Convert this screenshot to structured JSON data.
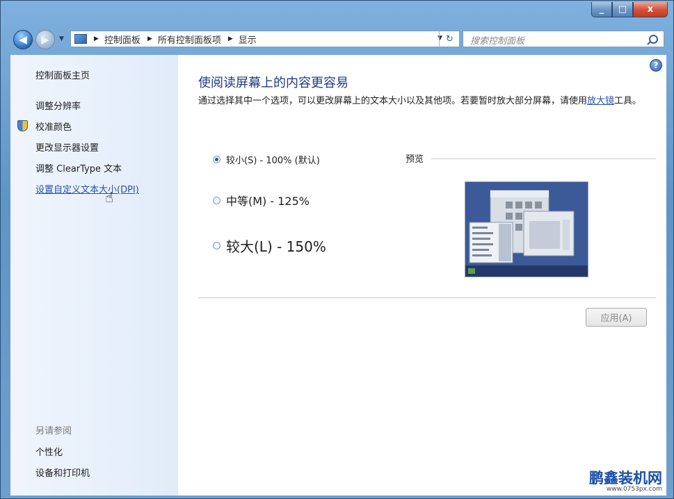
{
  "window": {
    "caption": {
      "minimize": "_",
      "maximize": "□",
      "close": "x"
    }
  },
  "nav": {
    "back": "◀",
    "forward": "▶",
    "history": "▼",
    "breadcrumbs": [
      "控制面板",
      "所有控制面板项",
      "显示"
    ],
    "sep": "▶",
    "dropdown": "▼",
    "refresh": "↻",
    "search_placeholder": "搜索控制面板"
  },
  "sidebar": {
    "home": "控制面板主页",
    "tasks": [
      "调整分辨率",
      "校准颜色",
      "更改显示器设置",
      "调整 ClearType 文本",
      "设置自定义文本大小(DPI)"
    ],
    "see_also_label": "另请参阅",
    "see_also": [
      "个性化",
      "设备和打印机"
    ]
  },
  "main": {
    "help": "?",
    "heading": "使阅读屏幕上的内容更容易",
    "desc_prefix": "通过选择其中一个选项，可以更改屏幕上的文本大小以及其他项。若要暂时放大部分屏幕，请使用",
    "desc_link": "放大镜",
    "desc_suffix": "工具。",
    "options": [
      {
        "label": "较小(S) - 100% (默认)",
        "selected": true
      },
      {
        "label": "中等(M) - 125%",
        "selected": false
      },
      {
        "label": "较大(L) - 150%",
        "selected": false
      }
    ],
    "preview_label": "预览",
    "apply": "应用(A)"
  },
  "watermark": {
    "title": "鹏鑫装机网",
    "url": "www.0753px.com"
  },
  "colors": {
    "link": "#2653b0",
    "heading": "#1e3b8a",
    "accent": "#2c57a5"
  }
}
